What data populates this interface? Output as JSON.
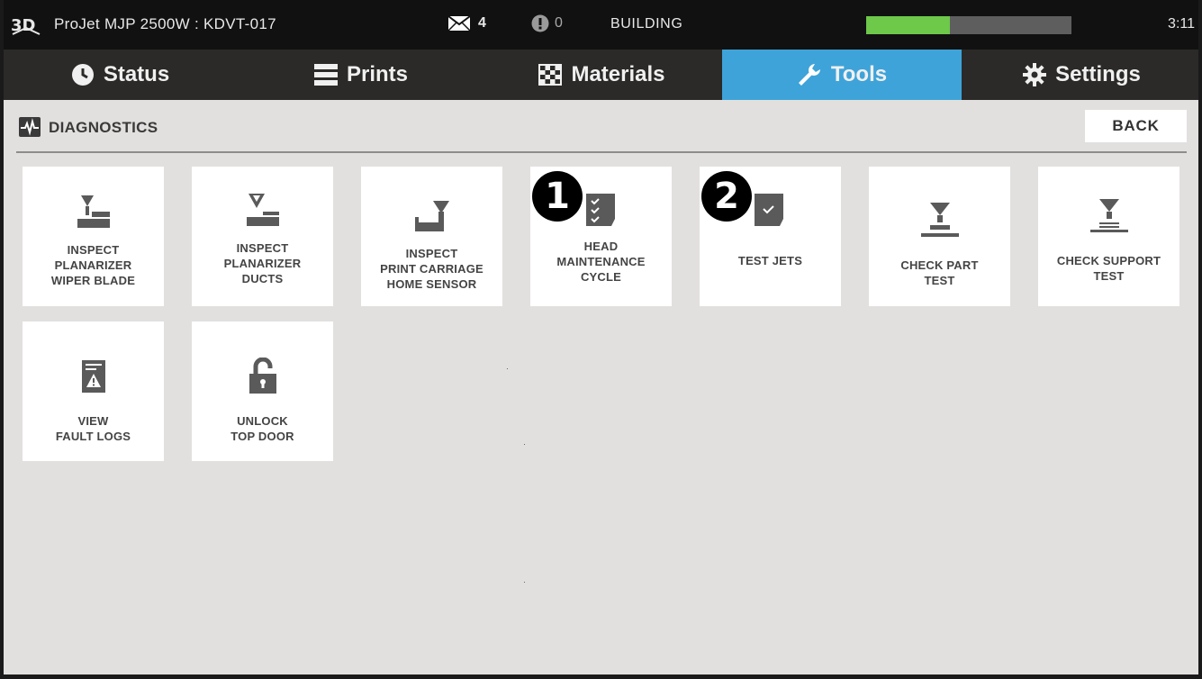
{
  "topbar": {
    "title": "ProJet MJP 2500W : KDVT-017",
    "messages_count": "4",
    "alerts_count": "0",
    "status": "BUILDING",
    "progress_fraction": 0.41,
    "time": "3:11"
  },
  "tabs": [
    {
      "label": "Status",
      "icon": "clock-icon"
    },
    {
      "label": "Prints",
      "icon": "list-icon"
    },
    {
      "label": "Materials",
      "icon": "checker-icon"
    },
    {
      "label": "Tools",
      "icon": "wrench-icon",
      "active": true
    },
    {
      "label": "Settings",
      "icon": "gear-icon"
    }
  ],
  "section": {
    "title": "DIAGNOSTICS",
    "back_label": "BACK"
  },
  "tiles": [
    {
      "lines": [
        "INSPECT",
        "PLANARIZER",
        "WIPER BLADE"
      ],
      "icon": "wiper-blade-icon"
    },
    {
      "lines": [
        "INSPECT",
        "PLANARIZER",
        "DUCTS"
      ],
      "icon": "planarizer-duct-icon"
    },
    {
      "lines": [
        "INSPECT",
        "PRINT CARRIAGE",
        "HOME SENSOR"
      ],
      "icon": "home-sensor-icon"
    },
    {
      "lines": [
        "HEAD",
        "MAINTENANCE",
        "CYCLE"
      ],
      "icon": "checklist-icon",
      "badge": "1"
    },
    {
      "lines": [
        "TEST JETS"
      ],
      "icon": "clipboard-check-icon",
      "badge": "2"
    },
    {
      "lines": [
        "CHECK PART",
        "TEST"
      ],
      "icon": "part-test-icon"
    },
    {
      "lines": [
        "CHECK SUPPORT",
        "TEST"
      ],
      "icon": "support-test-icon"
    },
    {
      "lines": [
        "VIEW",
        "FAULT LOGS"
      ],
      "icon": "fault-log-icon"
    },
    {
      "lines": [
        "UNLOCK",
        "TOP DOOR"
      ],
      "icon": "unlock-icon"
    }
  ],
  "colors": {
    "accent": "#3ea3d9",
    "progress": "#6ec84a",
    "background": "#e2e0de",
    "icon": "#5a5a5a"
  }
}
